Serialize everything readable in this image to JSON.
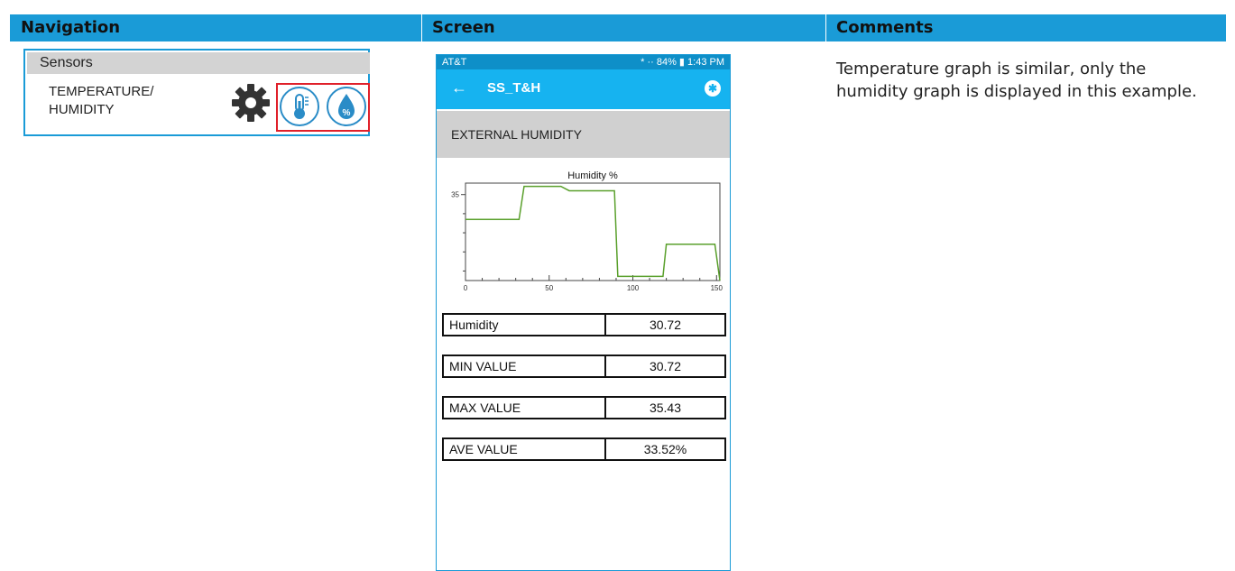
{
  "table": {
    "headers": [
      "Navigation",
      "Screen",
      "Comments"
    ]
  },
  "navigation": {
    "section_title": "Sensors",
    "item_label_line1": "TEMPERATURE/",
    "item_label_line2": "HUMIDITY",
    "icons": [
      "gear-icon",
      "thermometer-icon",
      "humidity-drop-icon"
    ],
    "highlight_color": "#e0202a"
  },
  "phone": {
    "status_left": "AT&T",
    "status_right": "* ·· 84% ▮ 1:43 PM",
    "app_title": "SS_T&H",
    "back_glyph": "←",
    "bluetooth_glyph": "✱",
    "section_header": "EXTERNAL HUMIDITY",
    "readings": [
      {
        "label": "Humidity",
        "value": "30.72"
      },
      {
        "label": "MIN VALUE",
        "value": "30.72"
      },
      {
        "label": "MAX VALUE",
        "value": "35.43"
      },
      {
        "label": "AVE VALUE",
        "value": "33.52%"
      }
    ],
    "accent": "#16b3f0"
  },
  "comments": {
    "text": "Temperature graph is similar, only the humidity graph is displayed in this example."
  },
  "chart_data": {
    "type": "line",
    "title": "Humidity  %",
    "xlabel": "",
    "ylabel": "",
    "xlim": [
      0,
      152
    ],
    "ylim": [
      30.5,
      35.6
    ],
    "xticks": [
      0,
      50,
      100,
      150
    ],
    "yticks": [
      35
    ],
    "series": [
      {
        "color": "#5aa02c",
        "x": [
          0,
          32,
          35,
          57,
          62,
          89,
          91,
          118,
          120,
          149,
          152
        ],
        "y": [
          33.7,
          33.7,
          35.43,
          35.43,
          35.2,
          35.2,
          30.72,
          30.72,
          32.4,
          32.4,
          30.5
        ]
      }
    ]
  }
}
